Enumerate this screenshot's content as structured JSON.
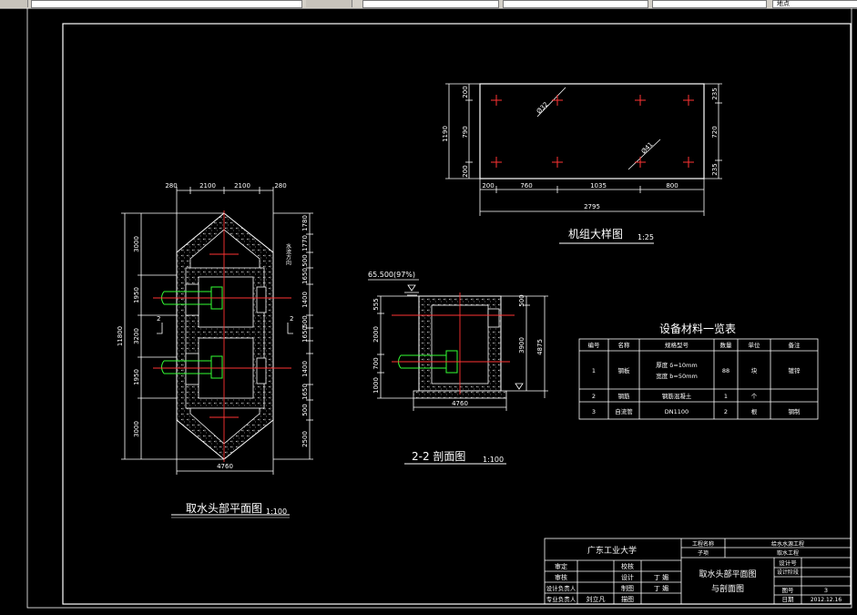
{
  "toolbar": {
    "label_right": "地点"
  },
  "top_view": {
    "title": "机组大样图",
    "scale": "1:25",
    "left_dims": [
      "1190",
      "200",
      "790",
      "200"
    ],
    "right_dims": [
      "235",
      "720",
      "235"
    ],
    "bottom_dims": [
      "200",
      "760",
      "1035",
      "800"
    ],
    "total_width": "2795",
    "bolt_labels": [
      "Ø32",
      "Ø41"
    ]
  },
  "plan": {
    "title": "取水头部平面图",
    "scale": "1:100",
    "top_dims": [
      "280",
      "2100",
      "2100",
      "280"
    ],
    "left_outer": "11800",
    "left_dims": [
      "3000",
      "1950",
      "3200",
      "1950",
      "3000"
    ],
    "right_dims": [
      "1780",
      "1770",
      "500",
      "1650",
      "1400",
      "500",
      "1650",
      "1400",
      "1650",
      "500",
      "2500"
    ],
    "bottom_width": "4760",
    "section_labels": [
      "2",
      "2"
    ],
    "side_note": "水流方向"
  },
  "section": {
    "title": "2-2 剖面图",
    "scale": "1:100",
    "elevation": "65.500(97%)",
    "left_dims": [
      "555",
      "2000",
      "700",
      "1000"
    ],
    "right_dims": [
      "500",
      "3900",
      "4875"
    ],
    "bottom_width": "4760"
  },
  "materials": {
    "title": "设备材料一览表",
    "headers": [
      "编号",
      "名称",
      "规格型号",
      "数量",
      "单位",
      "备注"
    ],
    "rows": [
      {
        "no": "1",
        "name": "钢板",
        "spec1": "厚度 δ=10mm",
        "spec2": "宽度 b=50mm",
        "qty": "88",
        "unit": "块",
        "note": "镀锌"
      },
      {
        "no": "2",
        "name": "钢筋",
        "spec1": "钢筋混凝土",
        "spec2": "",
        "qty": "1",
        "unit": "个",
        "note": ""
      },
      {
        "no": "3",
        "name": "自流管",
        "spec1": "DN1100",
        "spec2": "",
        "qty": "2",
        "unit": "根",
        "note": "钢制"
      }
    ]
  },
  "title_block": {
    "university": "广东工业大学",
    "project_label": "工程名称",
    "project_name": "给水水源工程",
    "sub_label": "子项",
    "sub_name": "取水工程",
    "drawing_line1": "取水头部平面图",
    "drawing_line2": "与剖面图",
    "roles": [
      "审定",
      "审核",
      "设计负责人",
      "专业负责人"
    ],
    "role_names": [
      "",
      "",
      "",
      "刘立凡"
    ],
    "actions": [
      "校核",
      "设计",
      "制图",
      "描图"
    ],
    "action_names": [
      "",
      "丁 媚",
      "丁 媚",
      ""
    ],
    "design_no_label": "设计号",
    "design_stage_label": "设计阶段",
    "sheet_no_label": "图号",
    "sheet_no": "3",
    "date_label": "日期",
    "date": "2012.12.16"
  }
}
